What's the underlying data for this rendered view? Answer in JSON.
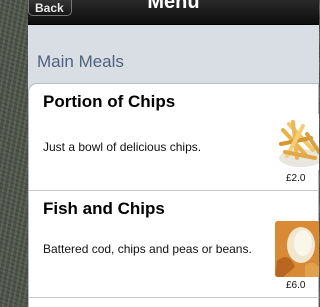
{
  "nav": {
    "back_label": "Back",
    "title": "Menu"
  },
  "section": {
    "header": "Main Meals"
  },
  "items": [
    {
      "title": "Portion of Chips",
      "description": "Just a bowl of delicious chips.",
      "price": "£2.0",
      "image_icon": "chips-photo"
    },
    {
      "title": "Fish and Chips",
      "description": "Battered cod, chips and peas or beans.",
      "price": "£6.0",
      "image_icon": "fish-and-chips-photo"
    }
  ],
  "colors": {
    "nav_bar": "#111111",
    "section_header": "#4f6380",
    "panel_background": "#d9dde4"
  }
}
